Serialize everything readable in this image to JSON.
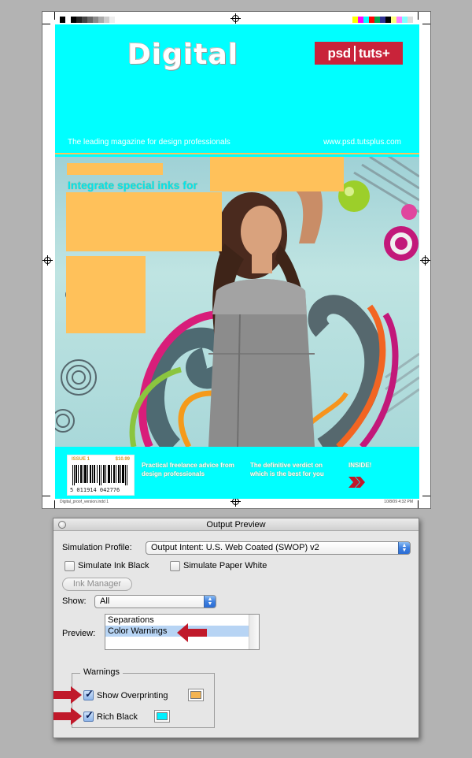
{
  "document": {
    "masthead": "Digital",
    "logo": {
      "left": "psd",
      "right": "tuts+"
    },
    "tagline": "The leading magazine for design professionals",
    "site_url": "www.psd.tutsplus.com",
    "headline": "Integrate special inks for",
    "barcode": {
      "issue": "ISSUE 1",
      "price": "$10.99",
      "number": "5 011914 042776"
    },
    "strip_text_1": "Practical freelance advice from design professionals",
    "strip_text_2": "The definitive verdict on which is the best for you",
    "strip_text_3": "INSIDE!",
    "footer_left": "Digital_proof_version.indd 1",
    "footer_right": "10/8/09 4:32 PM",
    "colors": {
      "cover": "#00ffff",
      "warning_orange": "#ffc15a",
      "logo_red": "#c9233a"
    }
  },
  "panel": {
    "title": "Output Preview",
    "simulation_profile_label": "Simulation Profile:",
    "simulation_profile_value": "Output Intent: U.S. Web Coated (SWOP) v2",
    "simulate_ink_black": "Simulate Ink Black",
    "simulate_paper_white": "Simulate Paper White",
    "ink_manager": "Ink Manager",
    "show_label": "Show:",
    "show_value": "All",
    "preview_label": "Preview:",
    "preview_options": [
      "Separations",
      "Color Warnings"
    ],
    "preview_selected": "Color Warnings",
    "warnings_title": "Warnings",
    "show_overprinting": "Show Overprinting",
    "rich_black": "Rich Black",
    "overprinting_color": "#f3b452",
    "rich_black_color": "#00f0ff",
    "arrow_color": "#c0192a"
  }
}
